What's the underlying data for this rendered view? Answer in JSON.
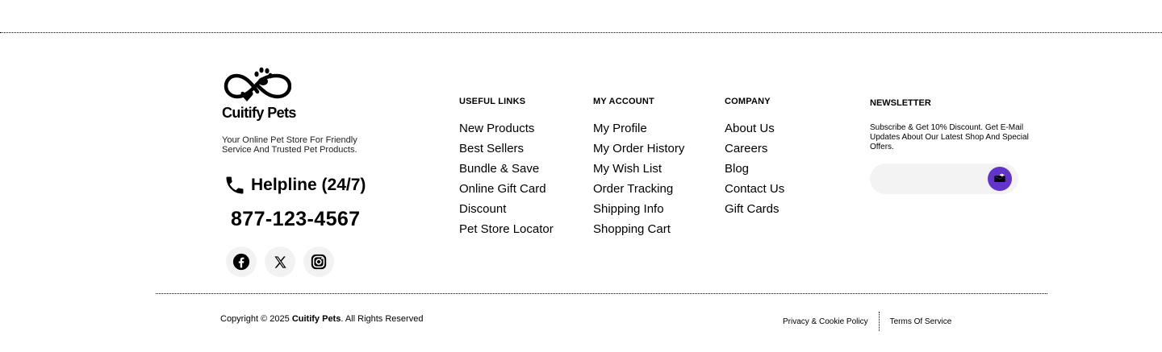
{
  "brand": {
    "name": "Cuitify Pets",
    "tagline": "Your Online Pet Store For Friendly Service And Trusted Pet Products."
  },
  "helpline": {
    "label": "Helpline (24/7)",
    "number": "877-123-4567"
  },
  "social": [
    {
      "name": "facebook-icon"
    },
    {
      "name": "x-icon"
    },
    {
      "name": "instagram-icon"
    }
  ],
  "columns": [
    {
      "title": "USEFUL LINKS",
      "links": [
        "New Products",
        "Best Sellers",
        "Bundle & Save",
        "Online Gift Card",
        "Discount",
        "Pet Store Locator"
      ]
    },
    {
      "title": "MY ACCOUNT",
      "links": [
        "My Profile",
        "My Order History",
        "My Wish List",
        "Order Tracking",
        "Shipping Info",
        "Shopping Cart"
      ]
    },
    {
      "title": "COMPANY",
      "links": [
        "About Us",
        "Careers",
        "Blog",
        "Contact Us",
        "Gift Cards"
      ]
    }
  ],
  "newsletter": {
    "title": "NEWSLETTER",
    "text": "Subscribe & Get 10% Discount. Get E-Mail Updates About Our Latest Shop And Special Offers.",
    "placeholder": "",
    "button_icon": "mail-send-icon",
    "accent": "#6234c9"
  },
  "footer": {
    "copyright_prefix": "Copyright © 2025 ",
    "copyright_brand": "Cuitify Pets",
    "copyright_suffix": ". All Rights Reserved",
    "privacy": "Privacy & Cookie Policy",
    "terms": "Terms Of Service"
  }
}
